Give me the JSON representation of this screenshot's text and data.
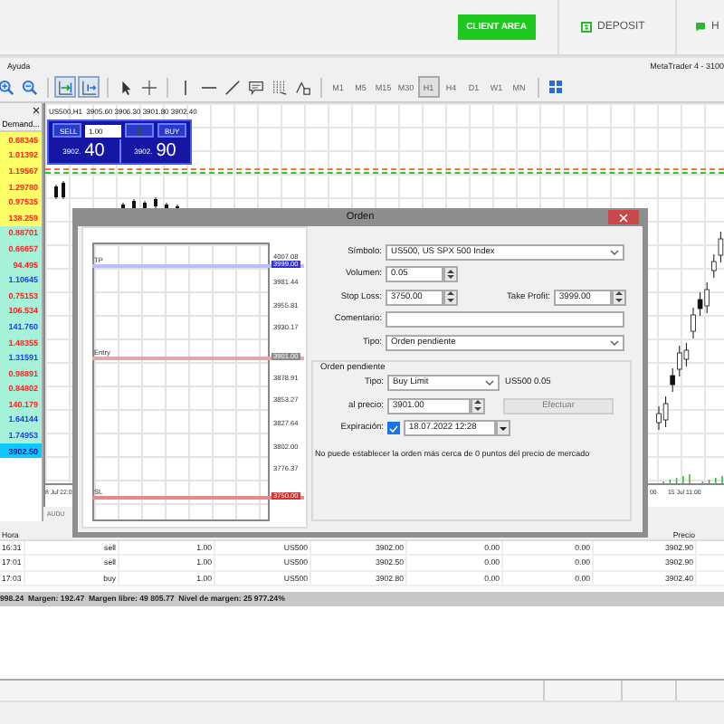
{
  "site_header": {
    "client_area": "CLIENT AREA",
    "deposit": "DEPOSIT",
    "help": "H"
  },
  "menubar": {
    "items": [
      "Ayuda"
    ],
    "title": "MetaTrader 4 - 3100"
  },
  "toolbar": {
    "tools": [
      {
        "kind": "zoom-in",
        "pressed": false
      },
      {
        "kind": "zoom-out",
        "pressed": false
      },
      {
        "kind": "autoscroll",
        "pressed": true
      },
      {
        "kind": "chart-shift",
        "pressed": true
      },
      {
        "kind": "cursor",
        "pressed": false
      },
      {
        "kind": "crosshair",
        "pressed": false
      },
      {
        "kind": "vline",
        "pressed": false
      },
      {
        "kind": "hline",
        "pressed": false
      },
      {
        "kind": "trendline",
        "pressed": false
      },
      {
        "kind": "text",
        "pressed": false
      },
      {
        "kind": "fibo",
        "pressed": false
      },
      {
        "kind": "shapes",
        "pressed": false
      }
    ],
    "timeframes": [
      {
        "label": "M1",
        "selected": false
      },
      {
        "label": "M5",
        "selected": false
      },
      {
        "label": "M15",
        "selected": false
      },
      {
        "label": "M30",
        "selected": false
      },
      {
        "label": "H1",
        "selected": true
      },
      {
        "label": "H4",
        "selected": false
      },
      {
        "label": "D1",
        "selected": false
      },
      {
        "label": "W1",
        "selected": false
      },
      {
        "label": "MN",
        "selected": false
      }
    ]
  },
  "market_watch": {
    "header": "Demand...",
    "rows": [
      {
        "value": "0.68345",
        "color": "#ff2020",
        "kind": "major"
      },
      {
        "value": "1.01392",
        "color": "#ff2020",
        "kind": "major"
      },
      {
        "value": "1.19567",
        "color": "#ff2020",
        "kind": "major"
      },
      {
        "value": "1.29780",
        "color": "#ff2020",
        "kind": "major"
      },
      {
        "value": "0.97535",
        "color": "#ff2020",
        "kind": "major"
      },
      {
        "value": "138.259",
        "color": "#ff2020",
        "kind": "major"
      },
      {
        "value": "0.88701",
        "color": "#ff2020",
        "kind": "cross"
      },
      {
        "value": "0.66657",
        "color": "#ff2020",
        "kind": "cross"
      },
      {
        "value": "94.495",
        "color": "#ff2020",
        "kind": "cross"
      },
      {
        "value": "1.10645",
        "color": "#2040e0",
        "kind": "cross"
      },
      {
        "value": "0.75153",
        "color": "#ff2020",
        "kind": "cross"
      },
      {
        "value": "106.534",
        "color": "#ff2020",
        "kind": "cross"
      },
      {
        "value": "141.760",
        "color": "#2040e0",
        "kind": "cross"
      },
      {
        "value": "1.48355",
        "color": "#ff2020",
        "kind": "cross"
      },
      {
        "value": "1.31591",
        "color": "#2040e0",
        "kind": "cross"
      },
      {
        "value": "0.98891",
        "color": "#ff2020",
        "kind": "cross"
      },
      {
        "value": "0.84802",
        "color": "#ff2020",
        "kind": "cross"
      },
      {
        "value": "140.179",
        "color": "#ff2020",
        "kind": "cross"
      },
      {
        "value": "1.64144",
        "color": "#2040e0",
        "kind": "cross"
      },
      {
        "value": "1.74953",
        "color": "#2040e0",
        "kind": "cross"
      },
      {
        "value": "3902.50",
        "color": "#1020a0",
        "kind": "index"
      }
    ]
  },
  "chart": {
    "header": "US500,H1  3905.60 3906.30 3901.80 3902.40",
    "time_labels": [
      "8 Jul 22:0",
      "00",
      "15 Jul 11:00"
    ],
    "tab": "AUDU"
  },
  "one_click": {
    "sell": "SELL",
    "volume": "1.00",
    "buy": "BUY",
    "bid_prefix": "3902.",
    "bid_pips": "40",
    "ask_prefix": "3902.",
    "ask_pips": "90"
  },
  "order_dialog": {
    "title": "Orden",
    "preview": {
      "lines": [
        {
          "kind": "tp",
          "label": "TP"
        },
        {
          "kind": "entry",
          "label": "Entry"
        },
        {
          "kind": "sl",
          "label": "SL"
        }
      ],
      "prices": [
        {
          "kind": "plain",
          "text": "4007.08"
        },
        {
          "kind": "tp",
          "text": "3999.00"
        },
        {
          "kind": "plain",
          "text": "3981.44"
        },
        {
          "kind": "plain",
          "text": "3955.81"
        },
        {
          "kind": "plain",
          "text": "3930.17"
        },
        {
          "kind": "entry",
          "text": "3901.00"
        },
        {
          "kind": "plain",
          "text": "3878.91"
        },
        {
          "kind": "plain",
          "text": "3853.27"
        },
        {
          "kind": "plain",
          "text": "3827.64"
        },
        {
          "kind": "plain",
          "text": "3802.00"
        },
        {
          "kind": "plain",
          "text": "3776.37"
        },
        {
          "kind": "sl",
          "text": "3750.00"
        }
      ]
    },
    "form": {
      "symbol_label": "Símbolo:",
      "symbol": "US500, US SPX 500 Index",
      "volume_label": "Volumen:",
      "volume": "0.05",
      "sl_label": "Stop Loss:",
      "sl": "3750.00",
      "tp_label": "Take Profit:",
      "tp": "3999.00",
      "comment_label": "Comentario:",
      "type_label": "Tipo:",
      "type": "Orden pendiente"
    },
    "pending": {
      "group": "Orden pendiente",
      "type_label": "Tipo:",
      "type": "Buy Limit",
      "summary": "US500 0.05",
      "price_label": "al precio:",
      "price": "3901.00",
      "submit": {
        "label": "Efectuar",
        "disabled": true
      },
      "expiry_label": "Expiración:",
      "expiry_checked": true,
      "expiry": "18.07.2022 12:28",
      "note": "No puede establecer la orden más cerca de 0 puntos del precio de mercado"
    }
  },
  "terminal": {
    "header": {
      "time": "Hora",
      "price": "Precio"
    },
    "rows": [
      [
        "16:31",
        "sell",
        "1.00",
        "US500",
        "3902.00",
        "0.00",
        "0.00",
        "3902.90"
      ],
      [
        "17:01",
        "sell",
        "1.00",
        "US500",
        "3902.50",
        "0.00",
        "0.00",
        "3902.90"
      ],
      [
        "17:03",
        "buy",
        "1.00",
        "US500",
        "3902.80",
        "0.00",
        "0.00",
        "3902.40"
      ]
    ],
    "summary": "998.24  Margen: 192.47  Margen libre: 49 805.77  Nivel de margen: 25 977.24%"
  }
}
